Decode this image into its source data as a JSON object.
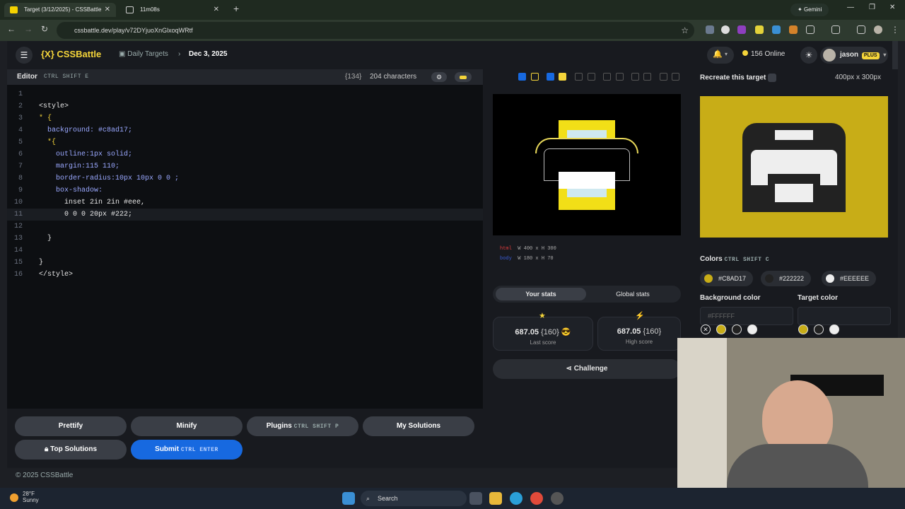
{
  "browser": {
    "tabs": [
      {
        "label": "Target (3/12/2025) - CSSBattle"
      },
      {
        "label": "11m08s"
      }
    ],
    "url": "cssbattle.dev/play/v72DYjuoXnGlxoqWRtf",
    "gemini": "Gemini"
  },
  "app": {
    "logo": "{X} CSSBattle",
    "crumb_daily": "Daily Targets",
    "crumb_date": "Dec 3, 2025",
    "online": "156 Online",
    "user": "jason",
    "plus_badge": "PLUS"
  },
  "editor": {
    "title": "Editor",
    "shortcut": "CTRL SHIFT E",
    "count_brace": "{134}",
    "chars": "204 characters",
    "lines": [
      {
        "n": "1",
        "t": ""
      },
      {
        "n": "2",
        "t": "<style>"
      },
      {
        "n": "3",
        "t": "* {"
      },
      {
        "n": "4",
        "t": "  background: #c8ad17;"
      },
      {
        "n": "5",
        "t": "  *{"
      },
      {
        "n": "6",
        "t": "    outline:1px solid;"
      },
      {
        "n": "7",
        "t": "    margin:115 110;"
      },
      {
        "n": "8",
        "t": "    border-radius:10px 10px 0 0 ;"
      },
      {
        "n": "9",
        "t": "    box-shadow:"
      },
      {
        "n": "10",
        "t": "      inset 2in 2in #eee,"
      },
      {
        "n": "11",
        "t": "      0 0 0 20px #222;"
      },
      {
        "n": "12",
        "t": ""
      },
      {
        "n": "13",
        "t": "  }"
      },
      {
        "n": "14",
        "t": ""
      },
      {
        "n": "15",
        "t": "}"
      },
      {
        "n": "16",
        "t": "</style>"
      }
    ]
  },
  "buttons": {
    "prettify": "Prettify",
    "minify": "Minify",
    "plugins": "Plugins",
    "plugins_kbd": "CTRL SHIFT P",
    "my_solutions": "My Solutions",
    "top_solutions": "Top Solutions",
    "submit": "Submit",
    "submit_kbd": "CTRL ENTER"
  },
  "footer": "© 2025 CSSBattle",
  "preview": {
    "info1_tag": "html",
    "info1": "W 400 x H 300",
    "info2_tag": "body",
    "info2": "W 180 x H 70",
    "tab_your": "Your stats",
    "tab_global": "Global stats",
    "last_value": "687.05",
    "last_sub": "{160}",
    "last_label": "Last score",
    "high_value": "687.05",
    "high_sub": "{160}",
    "high_label": "High score",
    "challenge": "Challenge"
  },
  "target": {
    "title": "Recreate this target",
    "size": "400px x 300px",
    "colors_title": "Colors",
    "colors_kbd": "CTRL SHIFT C",
    "colors": [
      {
        "hex": "#C8AD17"
      },
      {
        "hex": "#222222"
      },
      {
        "hex": "#EEEEEE"
      }
    ],
    "bg_label": "Background color",
    "target_label": "Target color",
    "bg_value": "#FFFFFF"
  },
  "taskbar": {
    "temp": "28°F",
    "weather": "Sunny",
    "search": "Search"
  },
  "palette": {
    "yellow": "#c8ad17",
    "dark": "#222222",
    "light": "#eeeeee",
    "blue": "#1769e0"
  }
}
